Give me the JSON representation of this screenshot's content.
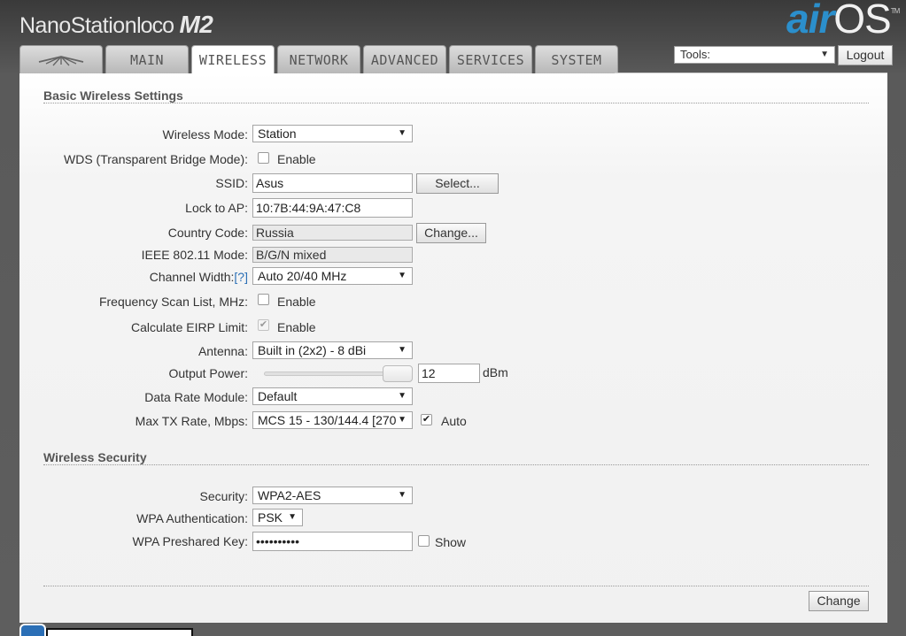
{
  "header": {
    "brand_main": "NanoStation",
    "brand_loco": "loco",
    "brand_model": "M2",
    "logo_air": "air",
    "logo_os": "OS",
    "logo_tm": "TM"
  },
  "tabs": [
    {
      "label": "",
      "active": false
    },
    {
      "label": "MAIN",
      "active": false
    },
    {
      "label": "WIRELESS",
      "active": true
    },
    {
      "label": "NETWORK",
      "active": false
    },
    {
      "label": "ADVANCED",
      "active": false
    },
    {
      "label": "SERVICES",
      "active": false
    },
    {
      "label": "SYSTEM",
      "active": false
    }
  ],
  "toolbar": {
    "tools_label": "Tools:",
    "logout_label": "Logout"
  },
  "basic": {
    "title": "Basic Wireless Settings",
    "wireless_mode_label": "Wireless Mode:",
    "wireless_mode_value": "Station",
    "wds_label": "WDS (Transparent Bridge Mode):",
    "wds_enable": "Enable",
    "ssid_label": "SSID:",
    "ssid_value": "Asus",
    "ssid_select": "Select...",
    "lock_label": "Lock to AP:",
    "lock_value": "10:7B:44:9A:47:C8",
    "country_label": "Country Code:",
    "country_value": "Russia",
    "country_change": "Change...",
    "ieee_label": "IEEE 802.11 Mode:",
    "ieee_value": "B/G/N mixed",
    "channel_width_label": "Channel Width:",
    "channel_width_help": "[?]",
    "channel_width_value": "Auto 20/40 MHz",
    "freq_scan_label": "Frequency Scan List, MHz:",
    "freq_scan_enable": "Enable",
    "eirp_label": "Calculate EIRP Limit:",
    "eirp_enable": "Enable",
    "antenna_label": "Antenna:",
    "antenna_value": "Built in (2x2) - 8 dBi",
    "output_power_label": "Output Power:",
    "output_power_value": "12",
    "output_power_unit": "dBm",
    "data_rate_label": "Data Rate Module:",
    "data_rate_value": "Default",
    "max_tx_label": "Max TX Rate, Mbps:",
    "max_tx_value": "MCS 15 - 130/144.4 [270",
    "max_tx_auto": "Auto"
  },
  "security": {
    "title": "Wireless Security",
    "security_label": "Security:",
    "security_value": "WPA2-AES",
    "wpa_auth_label": "WPA Authentication:",
    "wpa_auth_value": "PSK",
    "psk_label": "WPA Preshared Key:",
    "psk_value": "••••••••••",
    "psk_show": "Show"
  },
  "footer": {
    "change_label": "Change"
  },
  "icons": {
    "caret": "▼",
    "check": "✔"
  },
  "colors": {
    "accent": "#2b8fcc",
    "link": "#2b6fb6"
  }
}
